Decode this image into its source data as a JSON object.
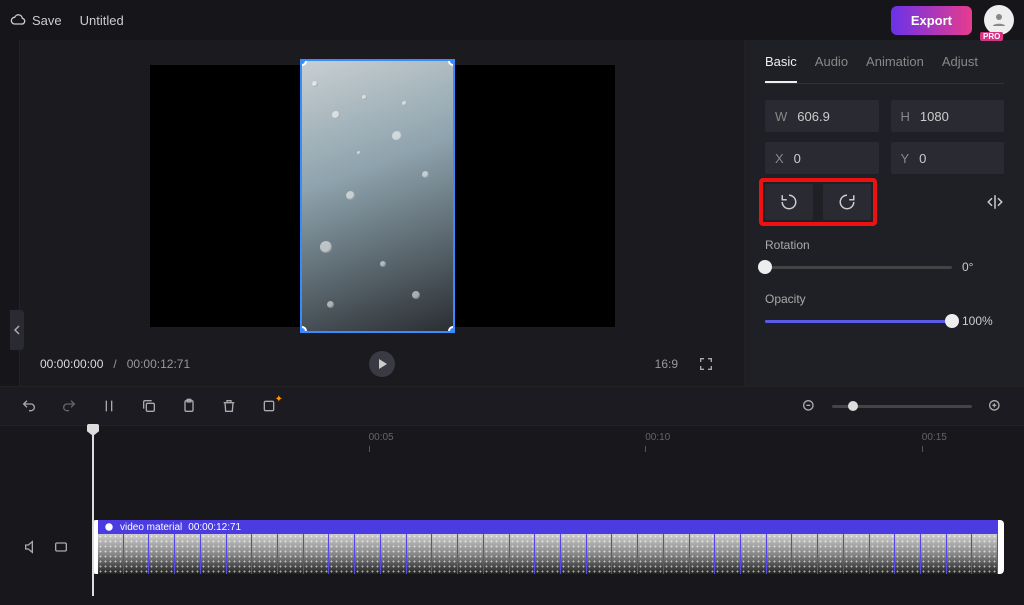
{
  "header": {
    "save_label": "Save",
    "title": "Untitled",
    "export_label": "Export",
    "pro_badge": "PRO"
  },
  "preview": {
    "current_time": "00:00:00:00",
    "separator": "/",
    "duration": "00:00:12:71",
    "aspect": "16:9"
  },
  "inspector": {
    "tabs": {
      "basic": "Basic",
      "audio": "Audio",
      "animation": "Animation",
      "adjust": "Adjust"
    },
    "w_label": "W",
    "w_value": "606.9",
    "h_label": "H",
    "h_value": "1080",
    "x_label": "X",
    "x_value": "0",
    "y_label": "Y",
    "y_value": "0",
    "rotation_label": "Rotation",
    "rotation_value": "0°",
    "opacity_label": "Opacity",
    "opacity_value": "100%"
  },
  "timeline": {
    "ticks": [
      "00:05",
      "00:10",
      "00:15"
    ],
    "clip_name": "video material",
    "clip_duration": "00:00:12:71"
  }
}
